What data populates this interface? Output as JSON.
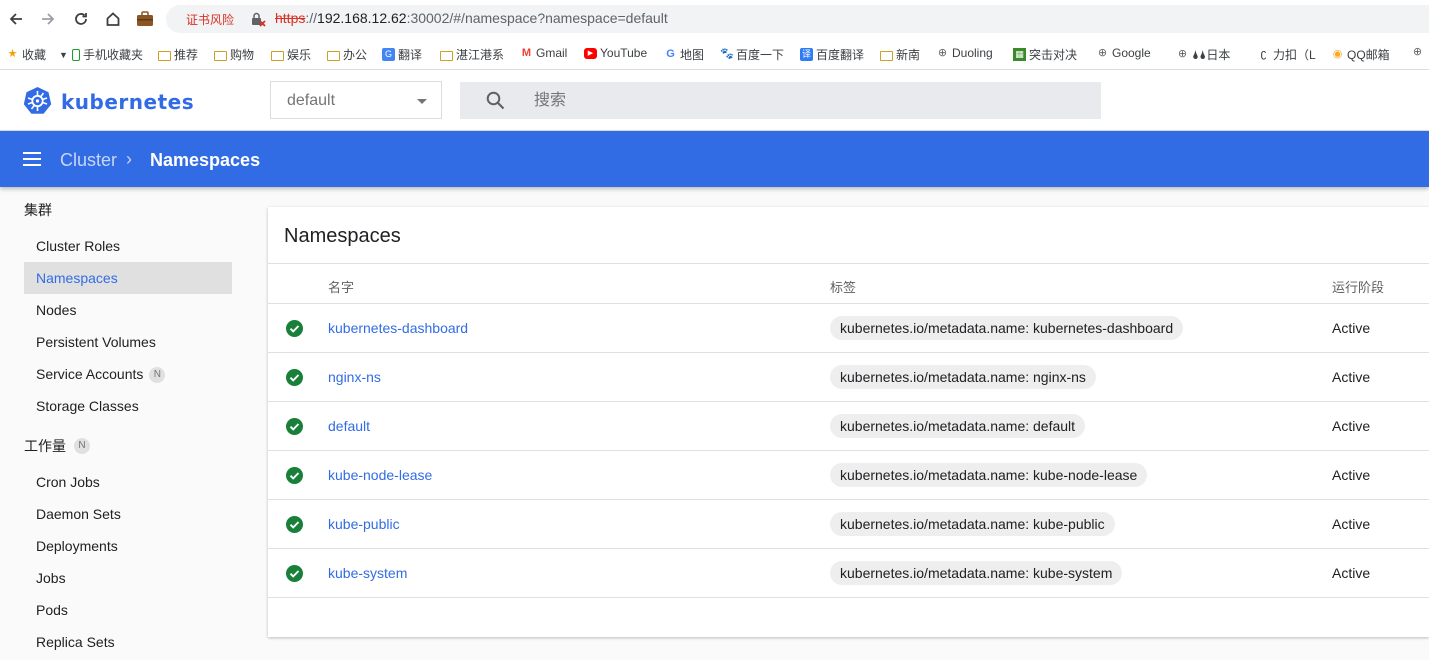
{
  "browser": {
    "cert_warning": "证书风险",
    "url_scheme": "https",
    "url_sep": "://",
    "url_host": "192.168.12.62",
    "url_rest": ":30002/#/namespace?namespace=default",
    "bookmarks": [
      {
        "label": "收藏",
        "icon": "star-icon"
      },
      {
        "label": "手机收藏夹",
        "icon": "phone-icon"
      },
      {
        "label": "推荐",
        "icon": "folder-icon"
      },
      {
        "label": "购物",
        "icon": "folder-icon"
      },
      {
        "label": "娱乐",
        "icon": "folder-icon"
      },
      {
        "label": "办公",
        "icon": "folder-icon"
      },
      {
        "label": "翻译",
        "icon": "translate-icon"
      },
      {
        "label": "湛江港系",
        "icon": "folder-icon"
      },
      {
        "label": "Gmail",
        "icon": "gmail-icon"
      },
      {
        "label": "YouTube",
        "icon": "youtube-icon"
      },
      {
        "label": "地图",
        "icon": "google-icon"
      },
      {
        "label": "百度一下",
        "icon": "baidu-icon"
      },
      {
        "label": "百度翻译",
        "icon": "baidu-translate-icon"
      },
      {
        "label": "新南",
        "icon": "folder-icon"
      },
      {
        "label": "Duoling",
        "icon": "globe-icon"
      },
      {
        "label": "突击对决",
        "icon": "grid-icon"
      },
      {
        "label": "Google",
        "icon": "globe-icon"
      },
      {
        "label": "🌢🌢日本",
        "icon": "globe-icon"
      },
      {
        "label": "力扣（L",
        "icon": "leetcode-icon"
      },
      {
        "label": "QQ邮箱",
        "icon": "qqmail-icon"
      }
    ]
  },
  "header": {
    "logo_text": "kubernetes",
    "namespace_select": "default",
    "search_placeholder": "搜索"
  },
  "toolbar": {
    "crumb_parent": "Cluster",
    "crumb_current": "Namespaces"
  },
  "sidebar": {
    "cluster_heading": "集群",
    "cluster_items": [
      {
        "label": "Cluster Roles",
        "active": false,
        "badge": ""
      },
      {
        "label": "Namespaces",
        "active": true,
        "badge": ""
      },
      {
        "label": "Nodes",
        "active": false,
        "badge": ""
      },
      {
        "label": "Persistent Volumes",
        "active": false,
        "badge": ""
      },
      {
        "label": "Service Accounts",
        "active": false,
        "badge": "N"
      },
      {
        "label": "Storage Classes",
        "active": false,
        "badge": ""
      }
    ],
    "workload_heading": "工作量",
    "workload_badge": "N",
    "workload_items": [
      {
        "label": "Cron Jobs"
      },
      {
        "label": "Daemon Sets"
      },
      {
        "label": "Deployments"
      },
      {
        "label": "Jobs"
      },
      {
        "label": "Pods"
      },
      {
        "label": "Replica Sets"
      }
    ]
  },
  "main": {
    "card_title": "Namespaces",
    "columns": {
      "name": "名字",
      "labels": "标签",
      "phase": "运行阶段"
    },
    "rows": [
      {
        "name": "kubernetes-dashboard",
        "label": "kubernetes.io/metadata.name: kubernetes-dashboard",
        "phase": "Active"
      },
      {
        "name": "nginx-ns",
        "label": "kubernetes.io/metadata.name: nginx-ns",
        "phase": "Active"
      },
      {
        "name": "default",
        "label": "kubernetes.io/metadata.name: default",
        "phase": "Active"
      },
      {
        "name": "kube-node-lease",
        "label": "kubernetes.io/metadata.name: kube-node-lease",
        "phase": "Active"
      },
      {
        "name": "kube-public",
        "label": "kubernetes.io/metadata.name: kube-public",
        "phase": "Active"
      },
      {
        "name": "kube-system",
        "label": "kubernetes.io/metadata.name: kube-system",
        "phase": "Active"
      }
    ]
  },
  "colors": {
    "brand": "#326ce5",
    "status_ok": "#188038"
  }
}
